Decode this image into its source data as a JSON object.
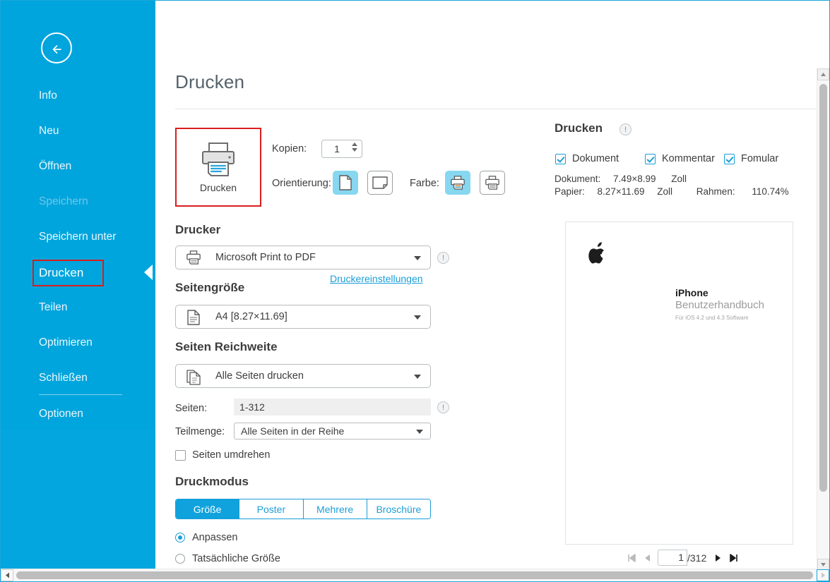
{
  "window": {
    "minimize": "–",
    "maximize": "□",
    "close": "✕"
  },
  "sidebar": {
    "back_icon": "back-arrow-icon",
    "items": [
      {
        "label": "Info",
        "state": "normal"
      },
      {
        "label": "Neu",
        "state": "normal"
      },
      {
        "label": "Öffnen",
        "state": "normal"
      },
      {
        "label": "Speichern",
        "state": "disabled"
      },
      {
        "label": "Speichern unter",
        "state": "normal"
      },
      {
        "label": "Drucken",
        "state": "active"
      },
      {
        "label": "Teilen",
        "state": "normal"
      },
      {
        "label": "Optimieren",
        "state": "normal"
      },
      {
        "label": "Schließen",
        "state": "normal"
      },
      {
        "label": "Optionen",
        "state": "normal"
      }
    ]
  },
  "main": {
    "page_title": "Drucken",
    "print_button": {
      "label": "Drucken",
      "icon": "printer-icon"
    },
    "copies": {
      "label": "Kopien:",
      "value": "1"
    },
    "orientation": {
      "label": "Orientierung:",
      "options": [
        "portrait",
        "landscape"
      ],
      "selected": "portrait"
    },
    "color": {
      "label": "Farbe:",
      "options": [
        "color",
        "grayscale"
      ],
      "selected": "color"
    },
    "printer": {
      "heading": "Drucker",
      "selected": "Microsoft Print to PDF",
      "settings_link": "Druckereinstellungen"
    },
    "page_size": {
      "heading": "Seitengröße",
      "selected": "A4 [8.27×11.69]"
    },
    "page_range": {
      "heading": "Seiten Reichweite",
      "selected": "Alle Seiten drucken",
      "pages_label": "Seiten:",
      "pages_value": "1-312",
      "subset_label": "Teilmenge:",
      "subset_value": "Alle Seiten in der Reihe",
      "reverse_label": "Seiten umdrehen",
      "reverse_checked": false
    },
    "print_mode": {
      "heading": "Druckmodus",
      "tabs": [
        {
          "label": "Größe",
          "active": true
        },
        {
          "label": "Poster",
          "active": false
        },
        {
          "label": "Mehrere",
          "active": false
        },
        {
          "label": "Broschüre",
          "active": false
        }
      ],
      "radios": [
        {
          "label": "Anpassen",
          "selected": true
        },
        {
          "label": "Tatsächliche Größe",
          "selected": false
        }
      ]
    }
  },
  "right_panel": {
    "heading": "Drucken",
    "info_icon": "info-icon",
    "checkboxes": [
      {
        "label": "Dokument",
        "checked": true
      },
      {
        "label": "Kommentar",
        "checked": true
      },
      {
        "label": "Fomular",
        "checked": true
      }
    ],
    "meta": {
      "doc_label": "Dokument:",
      "doc_value": "7.49×8.99",
      "doc_unit": "Zoll",
      "paper_label": "Papier:",
      "paper_value": "8.27×11.69",
      "paper_unit": "Zoll",
      "frame_label": "Rahmen:",
      "frame_value": "110.74%"
    },
    "preview": {
      "title": "iPhone",
      "subtitle": "Benutzerhandbuch",
      "caption": "Für iOS 4.2 und 4.3 Software",
      "logo_icon": "apple-logo-icon"
    },
    "pager": {
      "first_icon": "first-page-icon",
      "prev_icon": "prev-page-icon",
      "current": "1",
      "total": "/312",
      "next_icon": "next-page-icon",
      "last_icon": "last-page-icon"
    }
  },
  "colors": {
    "brand_blue": "#01a5dd",
    "accent_blue": "#1b9ed8",
    "highlight_red": "#d81f1f",
    "selected_tile": "#87d7f0"
  }
}
